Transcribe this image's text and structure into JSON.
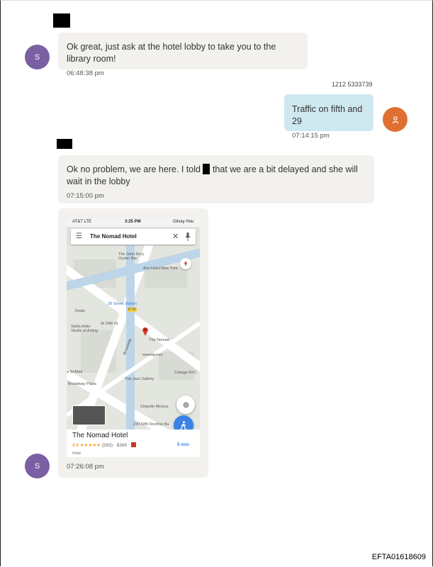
{
  "messages": [
    {
      "text": "Ok great, just ask at the hotel lobby to take you to the library room!",
      "time": "06:48:38 pm",
      "avatar": "S"
    },
    {
      "sender": "1212 5333739",
      "text": "Traffic on fifth and 29",
      "time": "07:14:15 pm"
    },
    {
      "text_part1": "Ok no problem, we are here. I told",
      "text_part2": "that we are a bit delayed and she will wait in the lobby",
      "time": "07:15:00 pm"
    },
    {
      "time": "07:26:08 pm",
      "avatar": "S"
    }
  ],
  "phone": {
    "carrier": "AT&T  LTE",
    "clock": "3:25 PM",
    "status_right": "Gilsey Hou",
    "search_text": "The Nomad Hotel",
    "map_labels": {
      "john_dory": "The John Dory\nOyster Bar",
      "ace_hotel": "Ace Hotel New York",
      "station": "28 Street Station",
      "station_lines": "R W",
      "deals": "Deals",
      "street_w29": "W 29th St",
      "stella": "Stella Adler\nStudio of Acting",
      "broadway": "Broadway",
      "nomad": "The Nomad",
      "sweetgreen": "sweetgreen",
      "lanomad": "a NoMad",
      "broadway_plaza": "Broadway Plaza",
      "jazz": "The Jazz Gallery",
      "collage": "Collage NYC",
      "chipotle": "Chipotle Mexica",
      "fifth_rooftop": "230 Fifth Rooftop Ba"
    },
    "place_name": "The Nomad Hotel",
    "rating": "4.6",
    "stars": "★★★★★",
    "reviews": "(593) · $365 ·",
    "eta": "5 min",
    "category": "Hotel"
  },
  "footer": "EFTA01618609",
  "colors": {
    "avatar_s": "#7b5fa3",
    "avatar_me": "#e07032",
    "bubble_in": "#f2f1ee",
    "bubble_out": "#cfe8f0"
  }
}
